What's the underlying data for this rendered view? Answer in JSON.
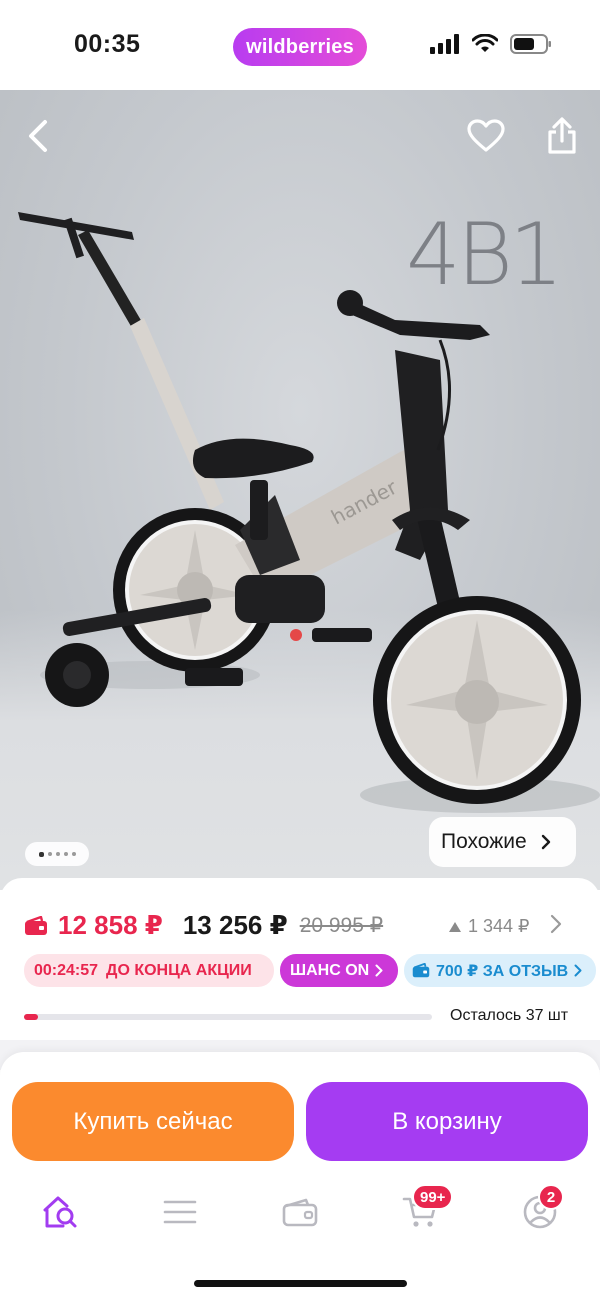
{
  "status_bar": {
    "time": "00:35",
    "brand": "wildberries"
  },
  "hero": {
    "badge_text": "4В1",
    "similar_label": "Похожие",
    "photo_count": 5,
    "active_photo": 1,
    "bike_brand_text": "hander",
    "icons": {
      "back": "back-chevron-icon",
      "favorite": "heart-icon",
      "share": "share-icon"
    }
  },
  "price": {
    "wallet_price": "12 858 ₽",
    "price": "13 256 ₽",
    "old_price": "20 995 ₽",
    "delta": "1 344 ₽",
    "colors": {
      "accent_red": "#e8264e"
    }
  },
  "chips": {
    "timer": "00:24:57",
    "timer_label": "ДО КОНЦА АКЦИИ",
    "chance": "ШАНС ON",
    "review": "700 ₽ ЗА ОТЗЫВ"
  },
  "stock": {
    "label": "Осталось 37 шт",
    "progress_fraction": 0.035
  },
  "actions": {
    "buy_now": "Купить сейчас",
    "add_to_cart": "В корзину",
    "colors": {
      "buy": "#fb8a2e",
      "cart": "#a53cf2"
    }
  },
  "tabbar": {
    "items": [
      {
        "name": "home",
        "icon": "home-search-icon"
      },
      {
        "name": "catalog",
        "icon": "menu-icon"
      },
      {
        "name": "wallet",
        "icon": "wallet-icon"
      },
      {
        "name": "cart",
        "icon": "cart-icon",
        "badge": "99+"
      },
      {
        "name": "profile",
        "icon": "profile-icon",
        "badge": "2"
      }
    ]
  }
}
